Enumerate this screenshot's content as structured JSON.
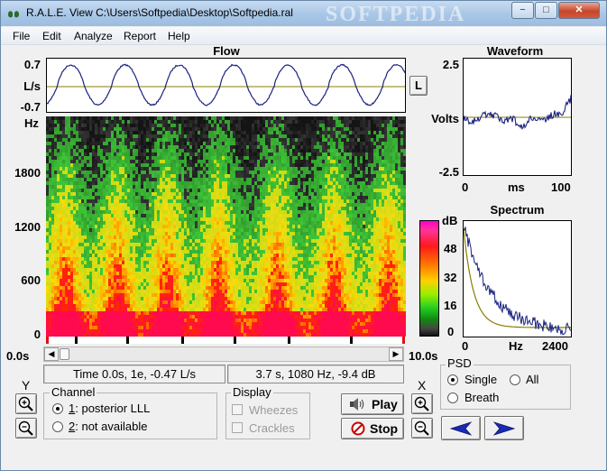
{
  "window": {
    "title": "R.A.L.E. View C:\\Users\\Softpedia\\Desktop\\Softpedia.ral",
    "watermark": "SOFTPEDIA",
    "minimize": "−",
    "maximize": "□",
    "close": "✕"
  },
  "menu": {
    "file": "File",
    "edit": "Edit",
    "analyze": "Analyze",
    "report": "Report",
    "help": "Help"
  },
  "flow": {
    "title": "Flow",
    "ymax": "0.7",
    "ymin": "-0.7",
    "unit": "L/s",
    "l_button": "L"
  },
  "spectrogram": {
    "unit": "Hz",
    "ticks": [
      "1800",
      "1200",
      "600",
      "0"
    ],
    "x_start": "0.0s",
    "x_end": "10.0s"
  },
  "waveform": {
    "title": "Waveform",
    "ymax": "2.5",
    "ymin": "-2.5",
    "unit": "Volts",
    "x0": "0",
    "xunit": "ms",
    "x1": "100"
  },
  "spectrum": {
    "title": "Spectrum",
    "db_unit": "dB",
    "db_ticks": [
      "48",
      "32",
      "16",
      "0"
    ],
    "x0": "0",
    "xunit": "Hz",
    "x1": "2400"
  },
  "status": {
    "left": "Time 0.0s, 1e, -0.47 L/s",
    "right": "3.7 s, 1080 Hz, -9.4 dB"
  },
  "psd": {
    "title": "PSD",
    "single": "Single",
    "all": "All",
    "breath": "Breath"
  },
  "zoom": {
    "y_label": "Y",
    "x_label": "X"
  },
  "channel": {
    "title": "Channel",
    "opt1_key": "1",
    "opt1_text": ": posterior LLL",
    "opt2_key": "2",
    "opt2_text": ": not available"
  },
  "display": {
    "title": "Display",
    "wheezes": "Wheezes",
    "crackles": "Crackles"
  },
  "buttons": {
    "play": "Play",
    "stop": "Stop"
  },
  "colors": {
    "series": "#1a237e",
    "baseline": "#8b7d00",
    "spec_low": "#2e2e2e",
    "spec_mid": "#22cc22",
    "spec_high": "#ff1a1a"
  }
}
